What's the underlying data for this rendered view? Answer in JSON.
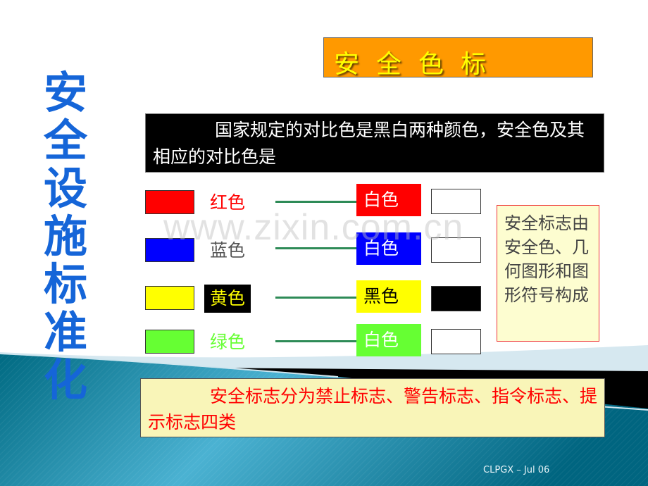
{
  "slide": {
    "vertical_title": [
      "安",
      "全",
      "设",
      "施",
      "标",
      "准",
      "化"
    ],
    "heading": "安全色标",
    "statement": "国家规定的对比色是黑白两种颜色，安全色及其相应的对比色是",
    "color_pairs": [
      {
        "safety_color": "红色",
        "safety_hex": "#ff0000",
        "label_text_color": "#ff0000",
        "label_bg": "transparent",
        "contrast": "白色",
        "contrast_label_bg": "#ff0000",
        "contrast_label_color": "#ffffff",
        "contrast_hex": "#ffffff"
      },
      {
        "safety_color": "蓝色",
        "safety_hex": "#0000ff",
        "label_text_color": "#555555",
        "label_bg": "transparent",
        "contrast": "白色",
        "contrast_label_bg": "#0000ff",
        "contrast_label_color": "#ffffff",
        "contrast_hex": "#ffffff"
      },
      {
        "safety_color": "黄色",
        "safety_hex": "#ffff00",
        "label_text_color": "#ffff00",
        "label_bg": "#000000",
        "contrast": "黑色",
        "contrast_label_bg": "#ffff00",
        "contrast_label_color": "#000000",
        "contrast_hex": "#000000"
      },
      {
        "safety_color": "绿色",
        "safety_hex": "#66ff33",
        "label_text_color": "#66ff33",
        "label_bg": "transparent",
        "contrast": "白色",
        "contrast_label_bg": "#66ff33",
        "contrast_label_color": "#ffffff",
        "contrast_hex": "#ffffff"
      }
    ],
    "side_note": "安全标志由安全色、几何图形和图形符号构成",
    "bottom_note": "安全标志分为禁止标志、警告标志、指令标志、提示标志四类",
    "watermark": "www.zixin.com.cn",
    "footer": "CLPGX – Jul 06"
  },
  "colors": {
    "title_blue": "#1565d8",
    "heading_bg": "#ff9900",
    "heading_text": "#ffff00",
    "bottom_box_bg": "#f9f5b8",
    "teal_dark": "#006f87",
    "teal_light": "#4fb4d4"
  }
}
